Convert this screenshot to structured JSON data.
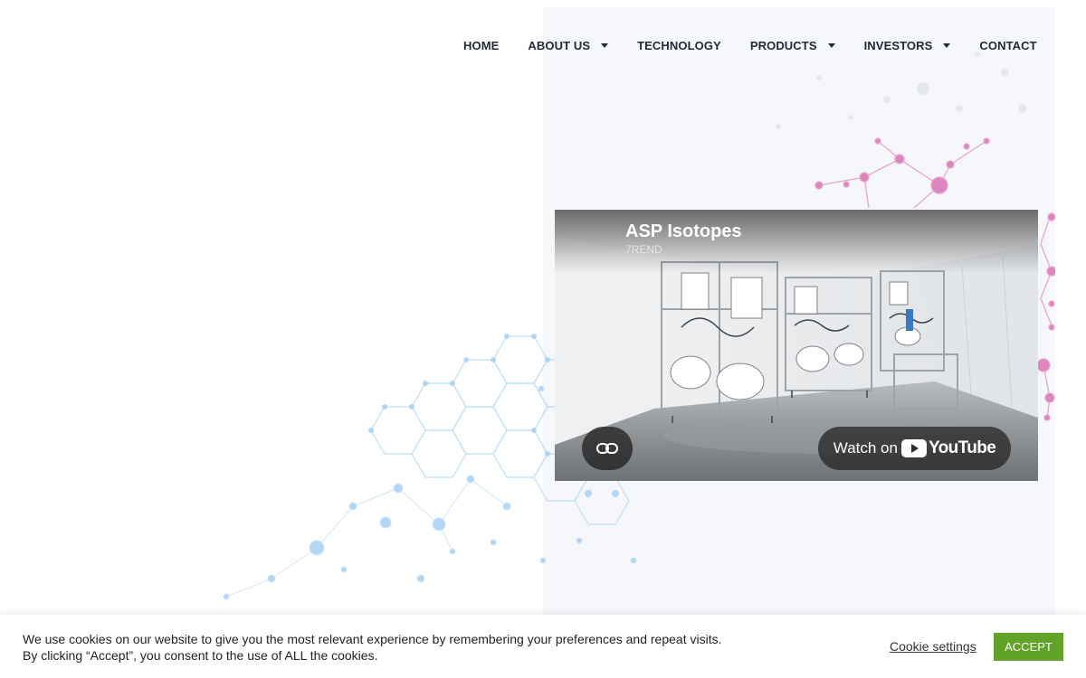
{
  "nav": {
    "items": [
      {
        "label": "HOME",
        "dropdown": false
      },
      {
        "label": "ABOUT US",
        "dropdown": true
      },
      {
        "label": "TECHNOLOGY",
        "dropdown": false
      },
      {
        "label": "PRODUCTS",
        "dropdown": true
      },
      {
        "label": "INVESTORS",
        "dropdown": true
      },
      {
        "label": "CONTACT",
        "dropdown": false
      }
    ]
  },
  "video": {
    "title": "ASP Isotopes",
    "channel": "7REND",
    "watch_label": "Watch on",
    "platform": "YouTube",
    "link_icon": "link-icon"
  },
  "cookie": {
    "message": "We use cookies on our website to give you the most relevant experience by remembering your preferences and repeat visits. By clicking “Accept”, you consent to the use of ALL the cookies.",
    "settings_label": "Cookie settings",
    "accept_label": "ACCEPT"
  },
  "colors": {
    "accept": "#61a229",
    "nav_text": "#222a35",
    "molecule_pink": "#d46bb0",
    "molecule_blue": "#8ec3ec"
  }
}
